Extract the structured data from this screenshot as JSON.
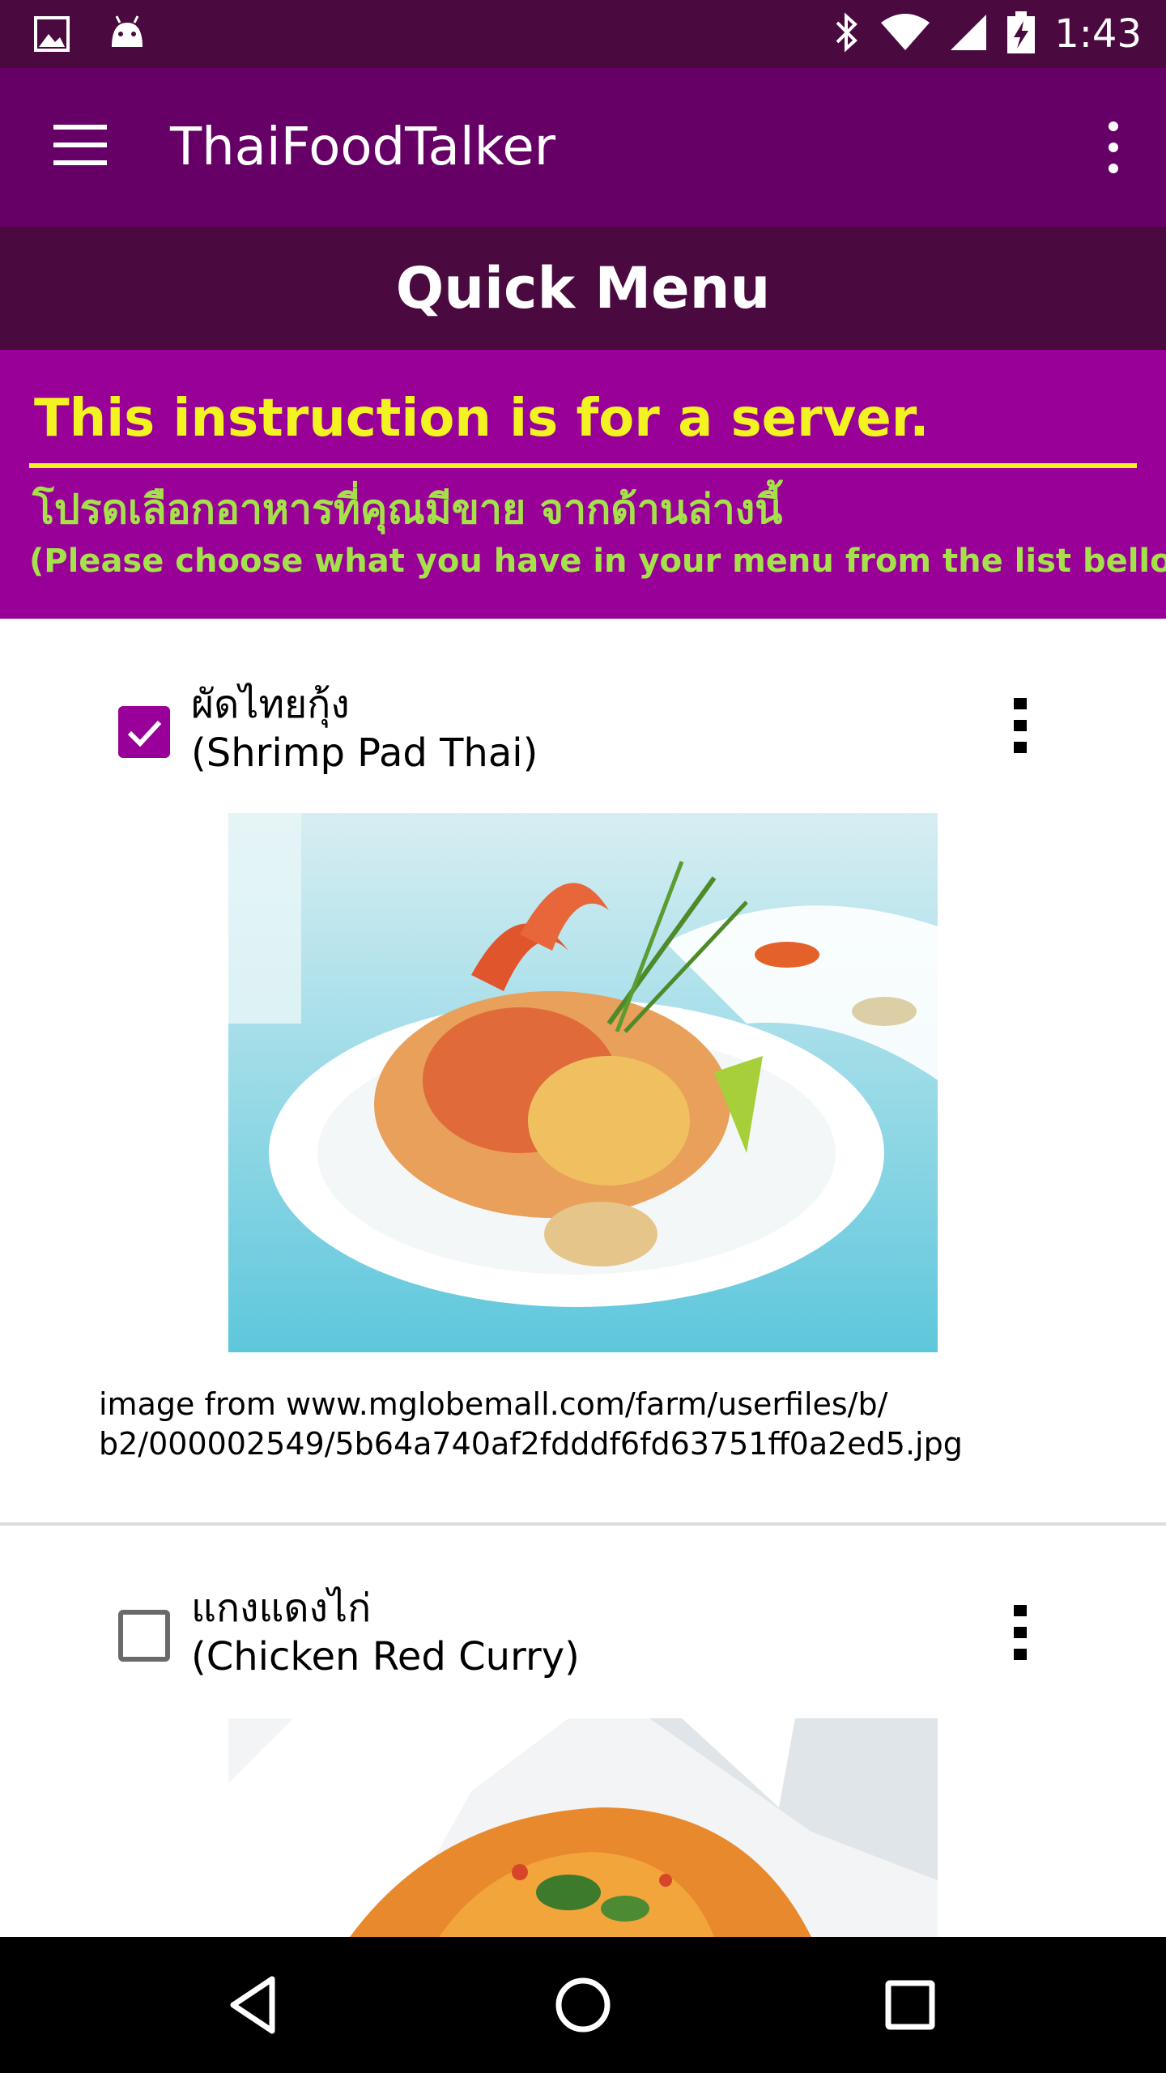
{
  "status_bar": {
    "time": "1:43",
    "icons": [
      "image-icon",
      "android-icon",
      "bluetooth-icon",
      "wifi-icon",
      "signal-icon",
      "battery-charging-icon"
    ]
  },
  "app_bar": {
    "title": "ThaiFoodTalker",
    "menu_icon": "hamburger-menu-icon",
    "overflow_icon": "more-vert-icon"
  },
  "section": {
    "title": "Quick Menu"
  },
  "instruction": {
    "title": "This instruction is for a server.",
    "thai_text": "โปรดเลือกอาหารที่คุณมีขาย จากด้านล่างนี้",
    "english_text": "(Please choose what you have in your menu from the list bellow.)"
  },
  "items": [
    {
      "thai_name": "ผัดไทยกุ้ง",
      "english_name": "(Shrimp Pad Thai)",
      "checked": true,
      "caption_line1": "image from www.mglobemall.com/farm/userfiles/b/",
      "caption_line2": "b2/000002549/5b64a740af2fdddf6fd63751ff0a2ed5.jpg"
    },
    {
      "thai_name": "แกงแดงไก่",
      "english_name": "(Chicken Red Curry)",
      "checked": false
    }
  ],
  "nav_bar": {
    "icons": [
      "back-icon",
      "home-icon",
      "recents-icon"
    ]
  },
  "colors": {
    "status_bar": "#4a0a3f",
    "app_bar": "#660066",
    "section_header": "#4a0a3f",
    "instruction_bg": "#980098",
    "instruction_title": "#f3f322",
    "instruction_text": "#a5e24a",
    "checkbox_checked": "#990099"
  }
}
